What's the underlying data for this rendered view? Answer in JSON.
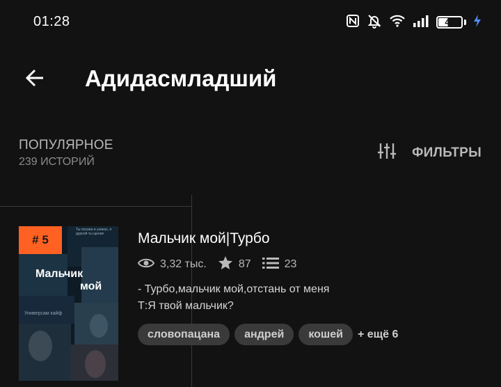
{
  "status_bar": {
    "time": "01:28",
    "battery": "40",
    "battery_level": 0.4,
    "icons": [
      "nfc-icon",
      "bell-off-icon",
      "wifi-icon",
      "signal-icon",
      "battery-icon",
      "charging-icon"
    ]
  },
  "app_bar": {
    "title": "Адидасмладший",
    "back_icon": "arrow-left-icon"
  },
  "sort": {
    "label": "ПОПУЛЯРНОЕ",
    "count": "239 ИСТОРИЙ",
    "filters_label": "ФИЛЬТРЫ",
    "filters_icon": "sliders-icon"
  },
  "story": {
    "rank": "# 5",
    "cover": {
      "title_line1": "Мальчик",
      "title_line2": "мой",
      "caption": "Универсам кайф",
      "top_text": "Ты похожа в униках, я дурной ты щение"
    },
    "title": "Мальчик мой|Турбо",
    "views": "3,32 тыс.",
    "votes": "87",
    "parts": "23",
    "description_line1": "- Турбо,мальчик мой,отстань от меня",
    "description_line2": "Т:Я твой мальчик?",
    "tags": [
      "словопацана",
      "андрей",
      "кошей"
    ],
    "more_tags": "+ ещё 6"
  },
  "colors": {
    "background": "#121212",
    "accent": "#ff6122",
    "tag_bg": "#3a3a3a",
    "text_secondary": "#b9b9b9"
  }
}
